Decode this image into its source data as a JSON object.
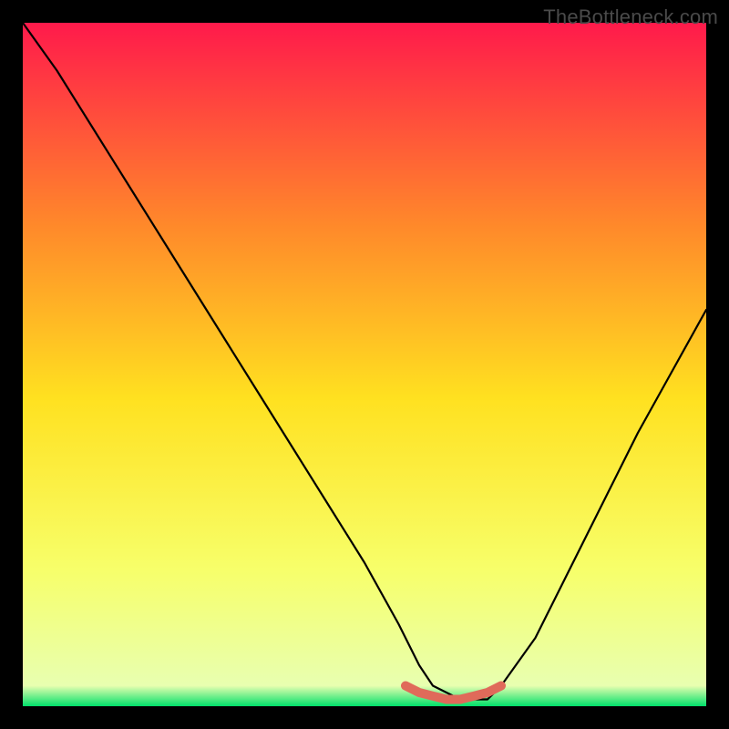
{
  "watermark": "TheBottleneck.com",
  "chart_data": {
    "type": "line",
    "title": "",
    "xlabel": "",
    "ylabel": "",
    "xlim": [
      0,
      100
    ],
    "ylim": [
      0,
      100
    ],
    "grid": false,
    "background_gradient": {
      "top": "#ff1a4b",
      "mid_upper": "#ff8a2a",
      "mid": "#ffe120",
      "mid_lower": "#f7ff6a",
      "bottom": "#00e06a"
    },
    "series": [
      {
        "name": "bottleneck-curve",
        "color": "#000000",
        "x": [
          0,
          5,
          10,
          15,
          20,
          25,
          30,
          35,
          40,
          45,
          50,
          55,
          58,
          60,
          64,
          68,
          70,
          75,
          80,
          85,
          90,
          95,
          100
        ],
        "values": [
          100,
          93,
          85,
          77,
          69,
          61,
          53,
          45,
          37,
          29,
          21,
          12,
          6,
          3,
          1,
          1,
          3,
          10,
          20,
          30,
          40,
          49,
          58
        ]
      },
      {
        "name": "optimal-segment",
        "color": "#e06a5a",
        "thick": true,
        "x": [
          56,
          58,
          60,
          62,
          64,
          66,
          68,
          70
        ],
        "values": [
          3,
          2,
          1.5,
          1,
          1,
          1.5,
          2,
          3
        ]
      }
    ]
  }
}
